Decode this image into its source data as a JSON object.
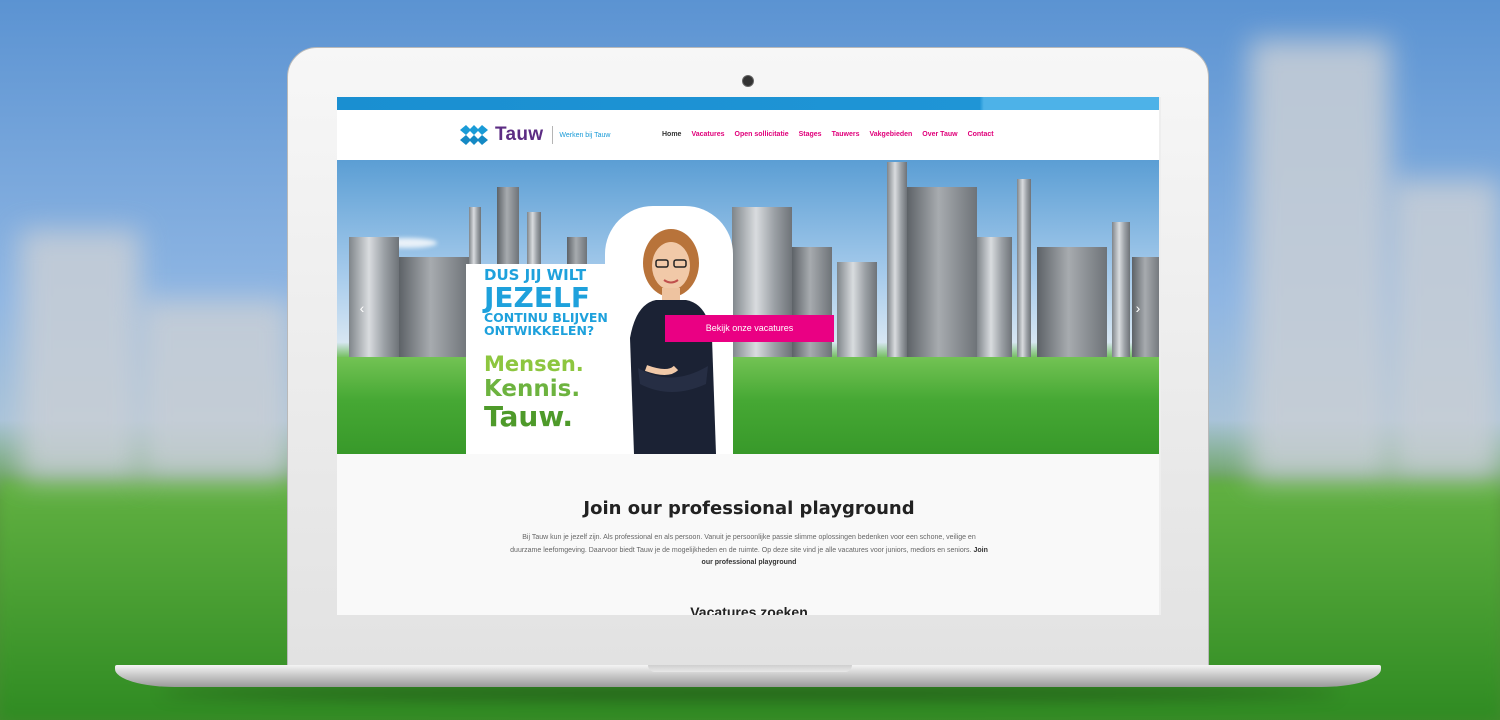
{
  "header": {
    "logo_text": "Tauw",
    "logo_sub": "Werken bij Tauw",
    "nav": [
      {
        "label": "Home",
        "active": true
      },
      {
        "label": "Vacatures"
      },
      {
        "label": "Open sollicitatie"
      },
      {
        "label": "Stages"
      },
      {
        "label": "Tauwers"
      },
      {
        "label": "Vakgebieden"
      },
      {
        "label": "Over Tauw"
      },
      {
        "label": "Contact"
      }
    ]
  },
  "hero": {
    "slogan_1": "DUS JIJ WILT",
    "slogan_2": "JEZELF",
    "slogan_3": "CONTINU BLIJVEN",
    "slogan_4": "ONTWIKKELEN?",
    "tag_1": "Mensen.",
    "tag_2": "Kennis.",
    "tag_3": "Tauw.",
    "cta_label": "Bekijk onze vacatures",
    "prev_arrow": "‹",
    "next_arrow": "›"
  },
  "content": {
    "title": "Join our professional playground",
    "body": "Bij Tauw kun je jezelf zijn. Als professional en als persoon. Vanuit je persoonlijke passie slimme oplossingen bedenken voor een schone, veilige en duurzame leefomgeving. Daarvoor biedt Tauw je de mogelijkheden en de ruimte. Op deze site vind je alle vacatures voor juniors, mediors en seniors.",
    "body_bold": "Join our professional playground",
    "next_heading": "Vacatures zoeken"
  },
  "colors": {
    "brand_purple": "#5c2c83",
    "brand_blue": "#1a9bd7",
    "accent_pink": "#ea0083",
    "green": "#5fb744"
  }
}
